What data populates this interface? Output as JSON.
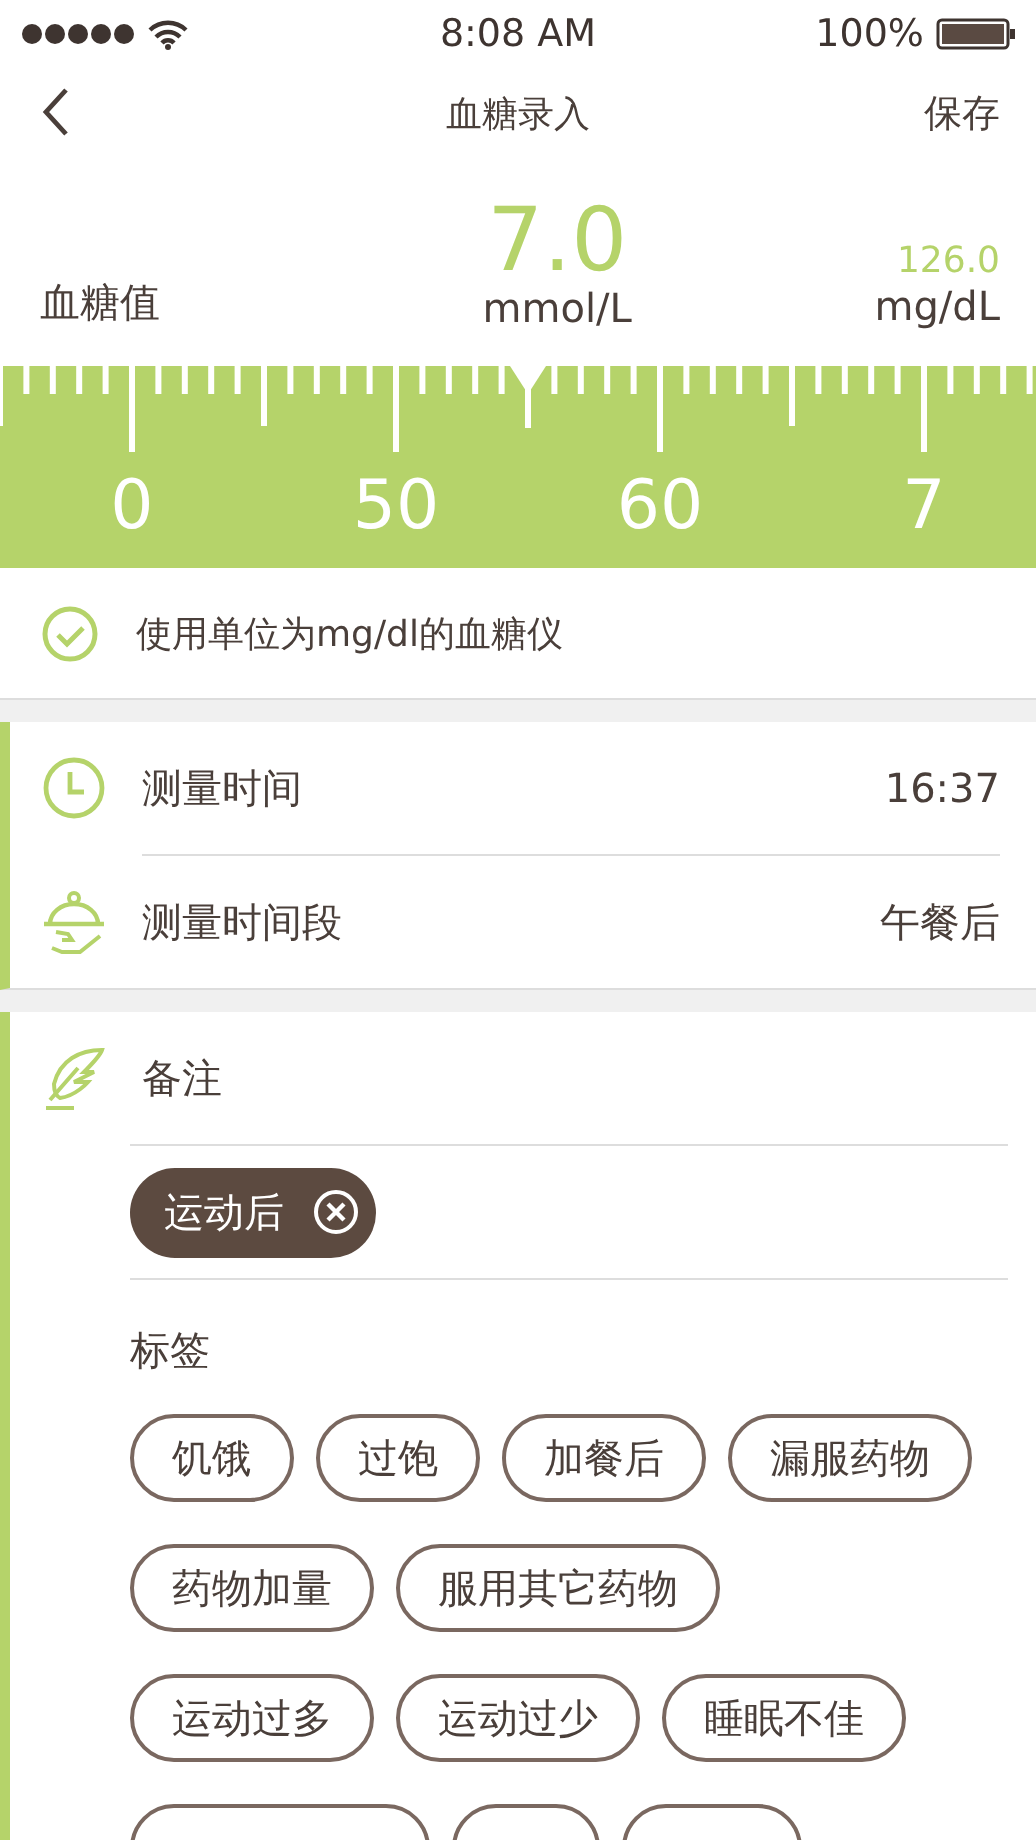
{
  "status_bar": {
    "time": "8:08 AM",
    "battery": "100%"
  },
  "nav": {
    "title": "血糖录入",
    "action": "保存"
  },
  "reading": {
    "label": "血糖值",
    "value": "7.0",
    "unit": "mmol/L",
    "alt_value": "126.0",
    "alt_unit": "mg/dL"
  },
  "ruler": {
    "labels": [
      "0",
      "50",
      "60",
      "7"
    ]
  },
  "unit_option": {
    "label": "使用单位为mg/dl的血糖仪",
    "checked": true
  },
  "measure": [
    {
      "kind": "time",
      "label": "测量时间",
      "value": "16:37"
    },
    {
      "kind": "period",
      "label": "测量时间段",
      "value": "午餐后"
    }
  ],
  "notes": {
    "title": "备注",
    "selected_tags": [
      {
        "label": "运动后"
      }
    ],
    "tags_title": "标签",
    "tag_rows": [
      [
        {
          "label": "饥饿"
        },
        {
          "label": "过饱"
        },
        {
          "label": "加餐后"
        },
        {
          "label": "漏服药物"
        }
      ],
      [
        {
          "label": "药物加量"
        },
        {
          "label": "服用其它药物"
        }
      ],
      [
        {
          "label": "运动过多"
        },
        {
          "label": "运动过少"
        },
        {
          "label": "睡眠不佳"
        }
      ]
    ]
  }
}
